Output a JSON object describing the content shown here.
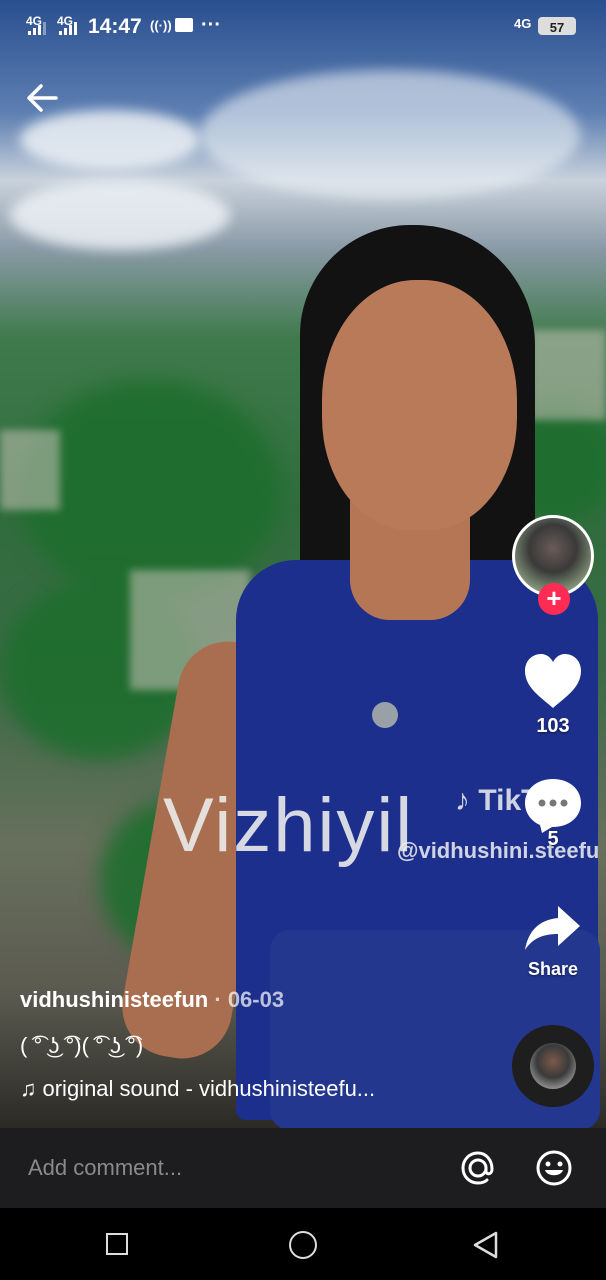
{
  "status_bar": {
    "signal1": "4G",
    "signal2": "4G",
    "time": "14:47",
    "network_right": "4G",
    "battery": "57"
  },
  "overlay": {
    "watermark_text": "Vizhiyil",
    "watermark_brand": "TikTok",
    "watermark_handle": "@vidhushini.steefu"
  },
  "actions": {
    "likes": "103",
    "comments": "5",
    "share_label": "Share"
  },
  "post": {
    "author": "vidhushinisteefun",
    "separator": " · ",
    "date": "06-03",
    "description": "( ͡° ͜ʖ ͡°)( ͡° ͜ʖ ͡°)",
    "sound": "original sound - vidhushinisteefu..."
  },
  "comment": {
    "placeholder": "Add comment..."
  },
  "colors": {
    "follow_badge": "#fe2c55",
    "comment_bar": "#1d1d1f"
  }
}
